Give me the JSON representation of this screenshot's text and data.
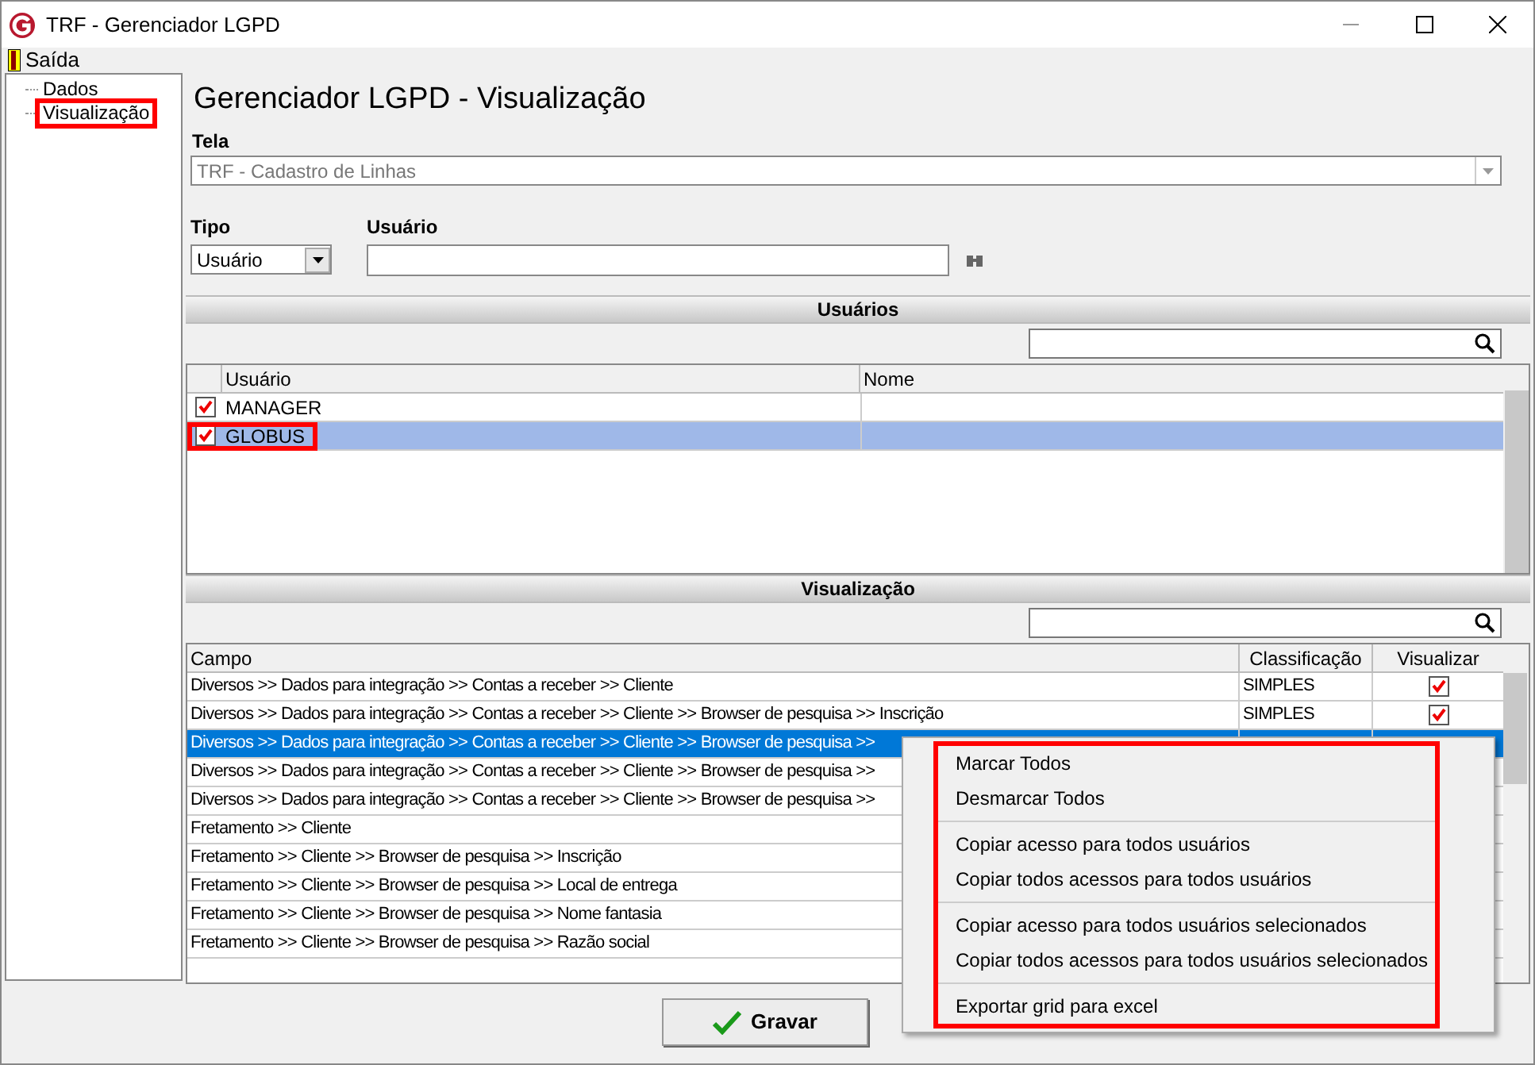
{
  "window": {
    "title": "TRF - Gerenciador LGPD"
  },
  "menu": [
    {
      "label": "Saída"
    }
  ],
  "tree": [
    {
      "label": "Dados",
      "annotated": false
    },
    {
      "label": "Visualização",
      "annotated": true
    }
  ],
  "heading": "Gerenciador LGPD - Visualização",
  "tela": {
    "label": "Tela",
    "value": "TRF - Cadastro de Linhas",
    "disabled": true
  },
  "tipo": {
    "label": "Tipo",
    "value": "Usuário"
  },
  "usuario": {
    "label": "Usuário"
  },
  "users_section": {
    "title": "Usuários",
    "columns": [
      "Usuário",
      "Nome"
    ],
    "rows": [
      {
        "usuario": "MANAGER",
        "checked": true,
        "selected": false,
        "annotated": false
      },
      {
        "usuario": "GLOBUS",
        "checked": true,
        "selected": true,
        "annotated": true
      }
    ]
  },
  "view_section": {
    "title": "Visualização",
    "columns": [
      "Campo",
      "Classificação",
      "Visualizar"
    ],
    "rows": [
      {
        "campo": "Diversos >> Dados para integração >> Contas a receber >> Cliente",
        "classificacao": "SIMPLES",
        "visualizar": true,
        "selected": false
      },
      {
        "campo": "Diversos >> Dados para integração >> Contas a receber >> Cliente >> Browser de pesquisa >> Inscrição",
        "classificacao": "SIMPLES",
        "visualizar": true,
        "selected": false
      },
      {
        "campo": "Diversos >> Dados para integração >> Contas a receber >> Cliente >> Browser de pesquisa >>",
        "selected": true
      },
      {
        "campo": "Diversos >> Dados para integração >> Contas a receber >> Cliente >> Browser de pesquisa >>",
        "selected": false
      },
      {
        "campo": "Diversos >> Dados para integração >> Contas a receber >> Cliente >> Browser de pesquisa >>",
        "selected": false
      },
      {
        "campo": "Fretamento >> Cliente",
        "selected": false
      },
      {
        "campo": "Fretamento >> Cliente >> Browser de pesquisa >> Inscrição",
        "selected": false
      },
      {
        "campo": "Fretamento >> Cliente >> Browser de pesquisa >> Local de entrega",
        "selected": false
      },
      {
        "campo": "Fretamento >> Cliente >> Browser de pesquisa >> Nome fantasia",
        "selected": false
      },
      {
        "campo": "Fretamento >> Cliente >> Browser de pesquisa >> Razão social",
        "selected": false
      }
    ]
  },
  "context_menu": {
    "annotated": true,
    "groups": [
      [
        "Marcar Todos",
        "Desmarcar Todos"
      ],
      [
        "Copiar acesso para todos usuários",
        "Copiar todos acessos para todos usuários"
      ],
      [
        "Copiar acesso para todos usuários selecionados",
        "Copiar todos acessos para todos usuários selecionados"
      ],
      [
        "Exportar grid para excel"
      ]
    ]
  },
  "save_button": {
    "label": "Gravar"
  }
}
